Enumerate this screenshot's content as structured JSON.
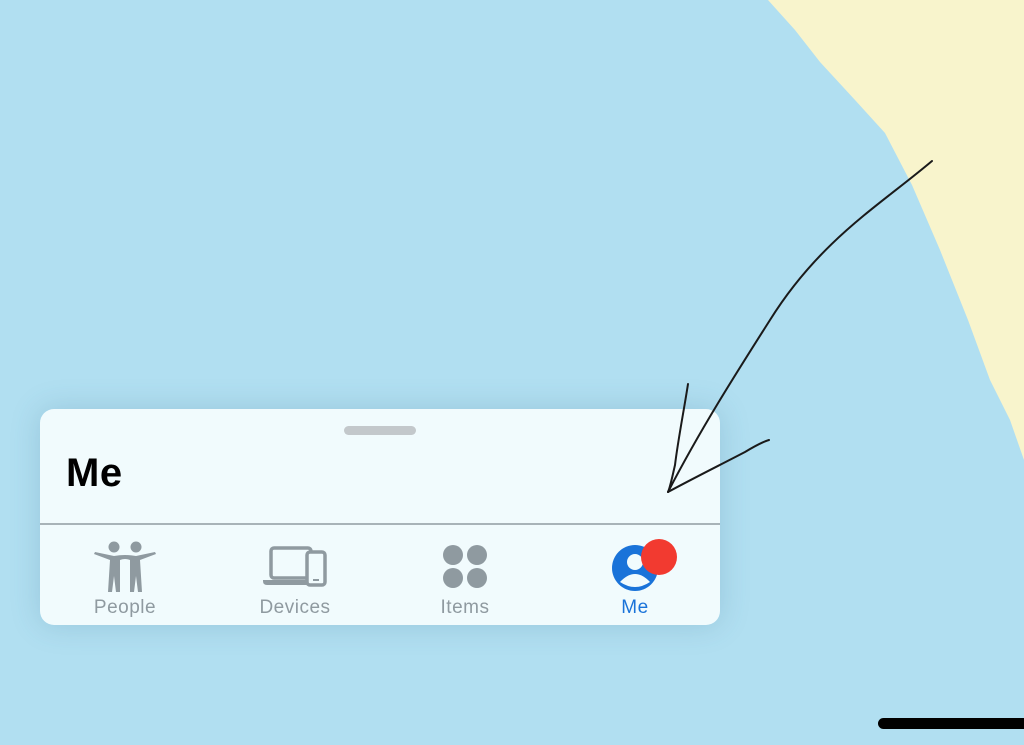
{
  "sheet": {
    "title": "Me"
  },
  "tabs": [
    {
      "label": "People",
      "icon": "people-icon",
      "active": false
    },
    {
      "label": "Devices",
      "icon": "devices-icon",
      "active": false
    },
    {
      "label": "Items",
      "icon": "items-icon",
      "active": false
    },
    {
      "label": "Me",
      "icon": "me-icon",
      "active": true
    }
  ],
  "colors": {
    "map_water": "#b1dff1",
    "map_land": "#f8f4cc",
    "sheet_background": "#f1fbfd",
    "inactive_tab": "#8f9aa0",
    "active_tab": "#1a73d9",
    "badge": "#f23a30"
  }
}
